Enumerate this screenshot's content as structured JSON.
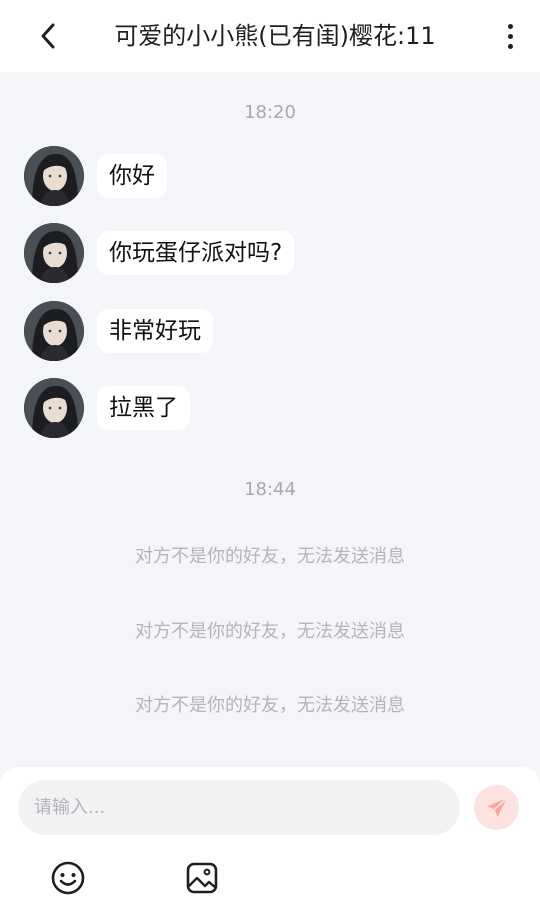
{
  "header": {
    "title": "可爱的小小熊(已有闺)樱花:11",
    "back_icon": "chevron-left-icon",
    "more_icon": "more-vertical-icon"
  },
  "messages": [
    {
      "time": "18:20"
    },
    {
      "text": "你好"
    },
    {
      "text": "你玩蛋仔派对吗?"
    },
    {
      "text": "非常好玩"
    },
    {
      "text": "拉黑了"
    }
  ],
  "second_time": "18:44",
  "system_notices": [
    "对方不是你的好友，无法发送消息",
    "对方不是你的好友，无法发送消息",
    "对方不是你的好友，无法发送消息"
  ],
  "composer": {
    "placeholder": "请输入...",
    "send_icon": "paper-plane-icon",
    "emoji_icon": "smiley-icon",
    "image_icon": "image-icon"
  },
  "colors": {
    "background": "#f4f5f8",
    "bubble": "#ffffff",
    "send_button": "#fde3df",
    "send_icon": "#f7a59a"
  }
}
